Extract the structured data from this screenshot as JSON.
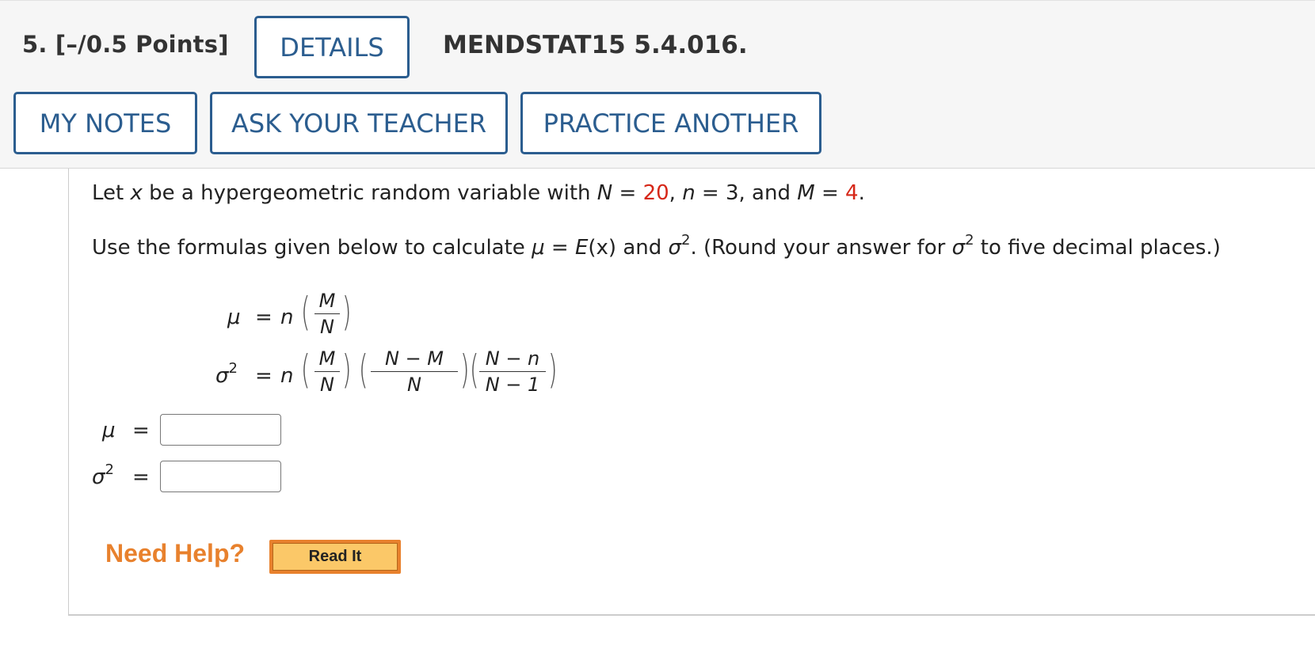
{
  "header": {
    "question_points": "5.  [–/0.5 Points]",
    "details_label": "DETAILS",
    "question_id": "MENDSTAT15 5.4.016.",
    "my_notes_label": "MY NOTES",
    "ask_teacher_label": "ASK YOUR TEACHER",
    "practice_another_label": "PRACTICE ANOTHER"
  },
  "problem": {
    "line1": {
      "p1": "Let ",
      "x": "x",
      "p2": " be a hypergeometric random variable with ",
      "N": "N",
      "eq1": " = ",
      "N_val": "20",
      "comma1": ", ",
      "n": "n",
      "p3": " = 3, and ",
      "M": "M",
      "eq2": " = ",
      "M_val": "4",
      "end": "."
    },
    "line2": {
      "p1": "Use the formulas given below to calculate ",
      "mu": "μ",
      "eq": " = ",
      "Ex": "E",
      "x": "(x)",
      "and": " and ",
      "sigma": "σ",
      "exp": "2",
      "p2": ". (Round your answer for ",
      "sigma2": "σ",
      "exp2": "2",
      "p3": " to five decimal places.)"
    }
  },
  "formulas": {
    "mu_lhs": "μ",
    "equals": "=",
    "n": "n",
    "M": "M",
    "N": "N",
    "sigma_lhs": "σ",
    "sq": "2",
    "N_minus_M": "N − M",
    "N_minus_n": "N − n",
    "N_minus_1": "N − 1"
  },
  "answers": {
    "mu_label": "μ",
    "sigma_label": "σ",
    "sq": "2",
    "equals": "=",
    "mu_value": "",
    "sigma2_value": ""
  },
  "help": {
    "need_help": "Need Help?",
    "read_it": "Read It"
  },
  "colors": {
    "accent_blue": "#2b5d8f",
    "red_value": "#d62718",
    "help_orange": "#e8812d"
  }
}
